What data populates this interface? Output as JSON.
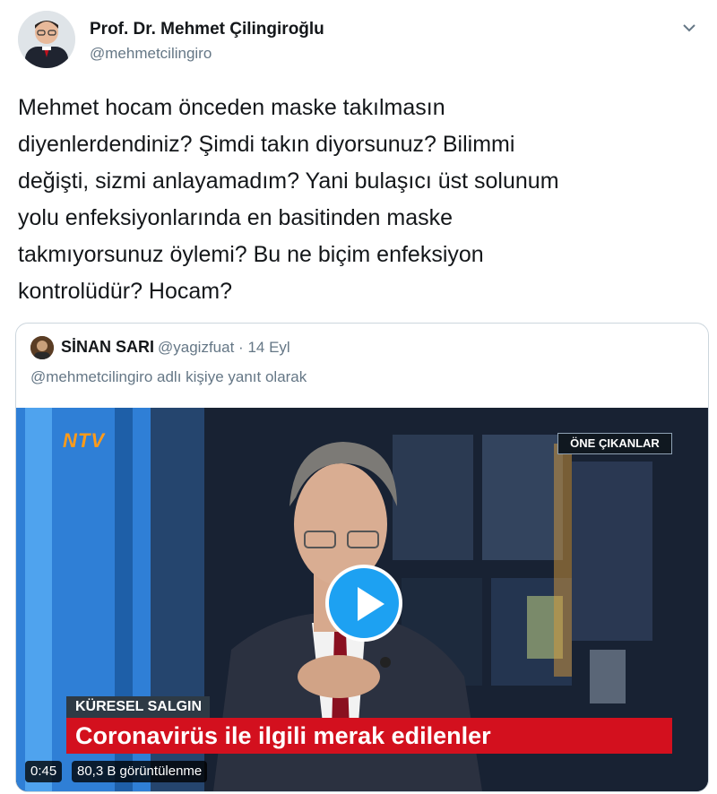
{
  "author": {
    "name": "Prof. Dr. Mehmet Çilingiroğlu",
    "handle": "@mehmetcilingiro"
  },
  "tweet": {
    "text": "Mehmet hocam önceden maske takılmasın\ndiyenlerdendiniz? Şimdi takın diyorsunuz? Bilimmi\ndeğişti, sizmi anlayamadım? Yani bulaşıcı üst solunum\nyolu enfeksiyonlarında en basitinden maske\ntakmıyorsunuz öylemi? Bu ne biçim enfeksiyon\nkontrolüdür? Hocam?"
  },
  "quoted": {
    "name": "SİNAN SARI",
    "handle": "@yagizfuat",
    "separator": "·",
    "date": "14 Eyl",
    "reply_to": "@mehmetcilingiro adlı kişiye yanıt olarak"
  },
  "video": {
    "logo_text": "NTV",
    "badge": "ÖNE ÇIKANLAR",
    "banner_small": "KÜRESEL SALGIN",
    "banner_main": "Coronavirüs ile ilgili merak edilenler",
    "duration": "0:45",
    "views": "80,3 B görüntülenme"
  },
  "icons": {
    "caret": "chevron-down-icon",
    "play": "play-icon"
  },
  "colors": {
    "accent": "#1da1f2",
    "secondary_text": "#657786",
    "banner_red": "#d3101e"
  }
}
